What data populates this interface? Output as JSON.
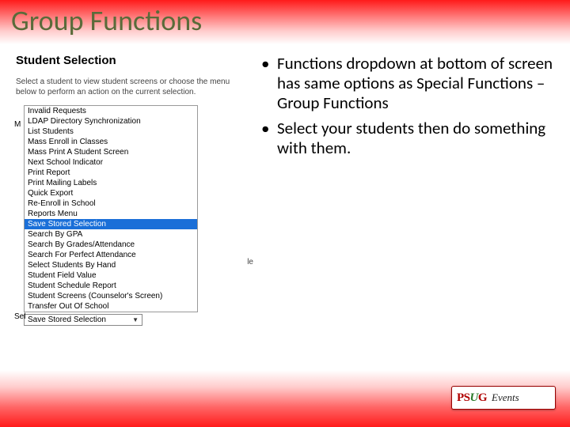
{
  "title": "Group Functions",
  "left": {
    "heading": "Student Selection",
    "instruction": "Select a student to view student screens or choose the menu below to perform an action on the current selection.",
    "m_label": "M",
    "sel_label": "Sel",
    "behind": "le",
    "dropdown": [
      "Invalid Requests",
      "LDAP Directory Synchronization",
      "List Students",
      "Mass Enroll in Classes",
      "Mass Print A Student Screen",
      "Next School Indicator",
      "Print Report",
      "Print Mailing Labels",
      "Quick Export",
      "Re-Enroll in School",
      "Reports Menu",
      "Save Stored Selection",
      "Search By GPA",
      "Search By Grades/Attendance",
      "Search For Perfect Attendance",
      "Select Students By Hand",
      "Student Field Value",
      "Student Schedule Report",
      "Student Screens (Counselor's Screen)",
      "Transfer Out Of School"
    ],
    "selected_index": 11,
    "select_value": "Save Stored Selection"
  },
  "bullets": [
    "Functions dropdown at bottom of screen has same options as Special Functions – Group Functions",
    "Select your students then do something with them."
  ],
  "logo": {
    "ps": "PS",
    "u": "U",
    "g": "G",
    "events": "Events"
  }
}
